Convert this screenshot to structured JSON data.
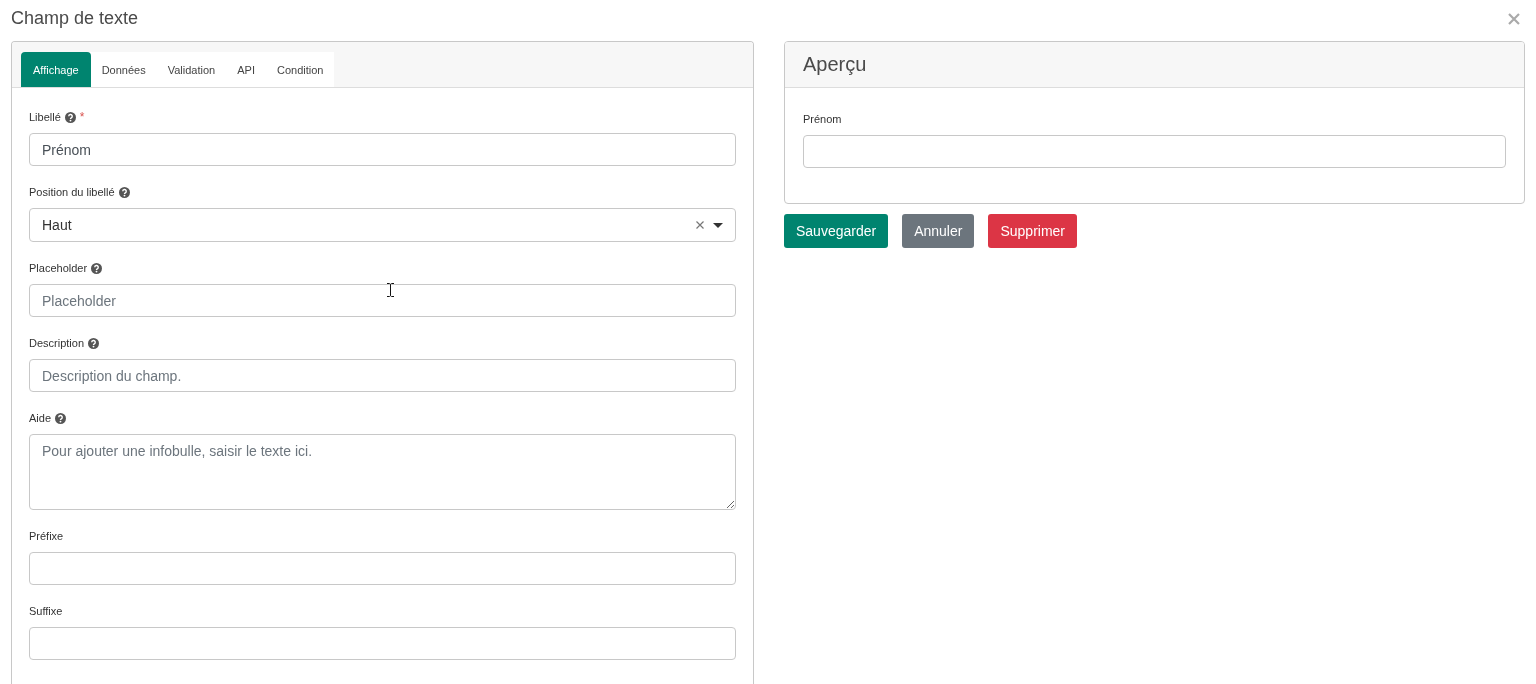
{
  "dialog": {
    "title": "Champ de texte"
  },
  "editor": {
    "tabs": [
      {
        "label": "Affichage",
        "selected": true
      },
      {
        "label": "Données",
        "selected": false
      },
      {
        "label": "Validation",
        "selected": false
      },
      {
        "label": "API",
        "selected": false
      },
      {
        "label": "Condition",
        "selected": false
      }
    ],
    "fields": [
      {
        "kind": "text",
        "label": "Libellé",
        "help": true,
        "required_mark": "*",
        "value": "Prénom"
      },
      {
        "kind": "select",
        "label": "Position du libellé",
        "help": true,
        "value": "Haut",
        "clearable": true
      },
      {
        "kind": "text",
        "label": "Placeholder",
        "help": true,
        "placeholder": "Placeholder"
      },
      {
        "kind": "text",
        "label": "Description",
        "help": true,
        "placeholder": "Description du champ."
      },
      {
        "kind": "textarea",
        "label": "Aide",
        "help": true,
        "placeholder": "Pour ajouter une infobulle, saisir le texte ici."
      },
      {
        "kind": "text",
        "label": "Préfixe",
        "help": false
      },
      {
        "kind": "text",
        "label": "Suffixe",
        "help": false
      }
    ]
  },
  "preview": {
    "title": "Aperçu",
    "field": {
      "kind": "text",
      "label": "Prénom",
      "help": false
    }
  },
  "buttons": [
    {
      "label": "Sauvegarder",
      "kind": "save"
    },
    {
      "label": "Annuler",
      "kind": "cancel"
    },
    {
      "label": "Supprimer",
      "kind": "delete"
    }
  ]
}
